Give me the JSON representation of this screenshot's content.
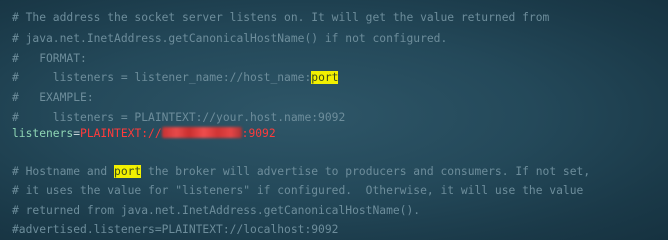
{
  "editor": {
    "lines": [
      "# The address the socket server listens on. It will get the value returned from",
      "# java.net.InetAddress.getCanonicalHostName() if not configured.",
      "#   FORMAT:",
      "#     listeners = listener_name://host_name:",
      "port",
      "#   EXAMPLE:",
      "#     listeners = PLAINTEXT://your.host.name:9092",
      "listeners",
      "=",
      "PLAINTEXT://",
      ":9092",
      "# Hostname and ",
      "port",
      " the broker will advertise to producers and consumers. If not set,",
      "# it uses the value for \"listeners\" if configured.  Otherwise, it will use the value",
      "# returned from java.net.InetAddress.getCanonicalHostName().",
      "#advertised.listeners=PLAINTEXT://localhost:9092"
    ]
  },
  "colors": {
    "background": "#24495a",
    "comment": "#6d8d9b",
    "key": "#8fd6b5",
    "value": "#ff3b3b",
    "highlight": "#f2f000"
  }
}
